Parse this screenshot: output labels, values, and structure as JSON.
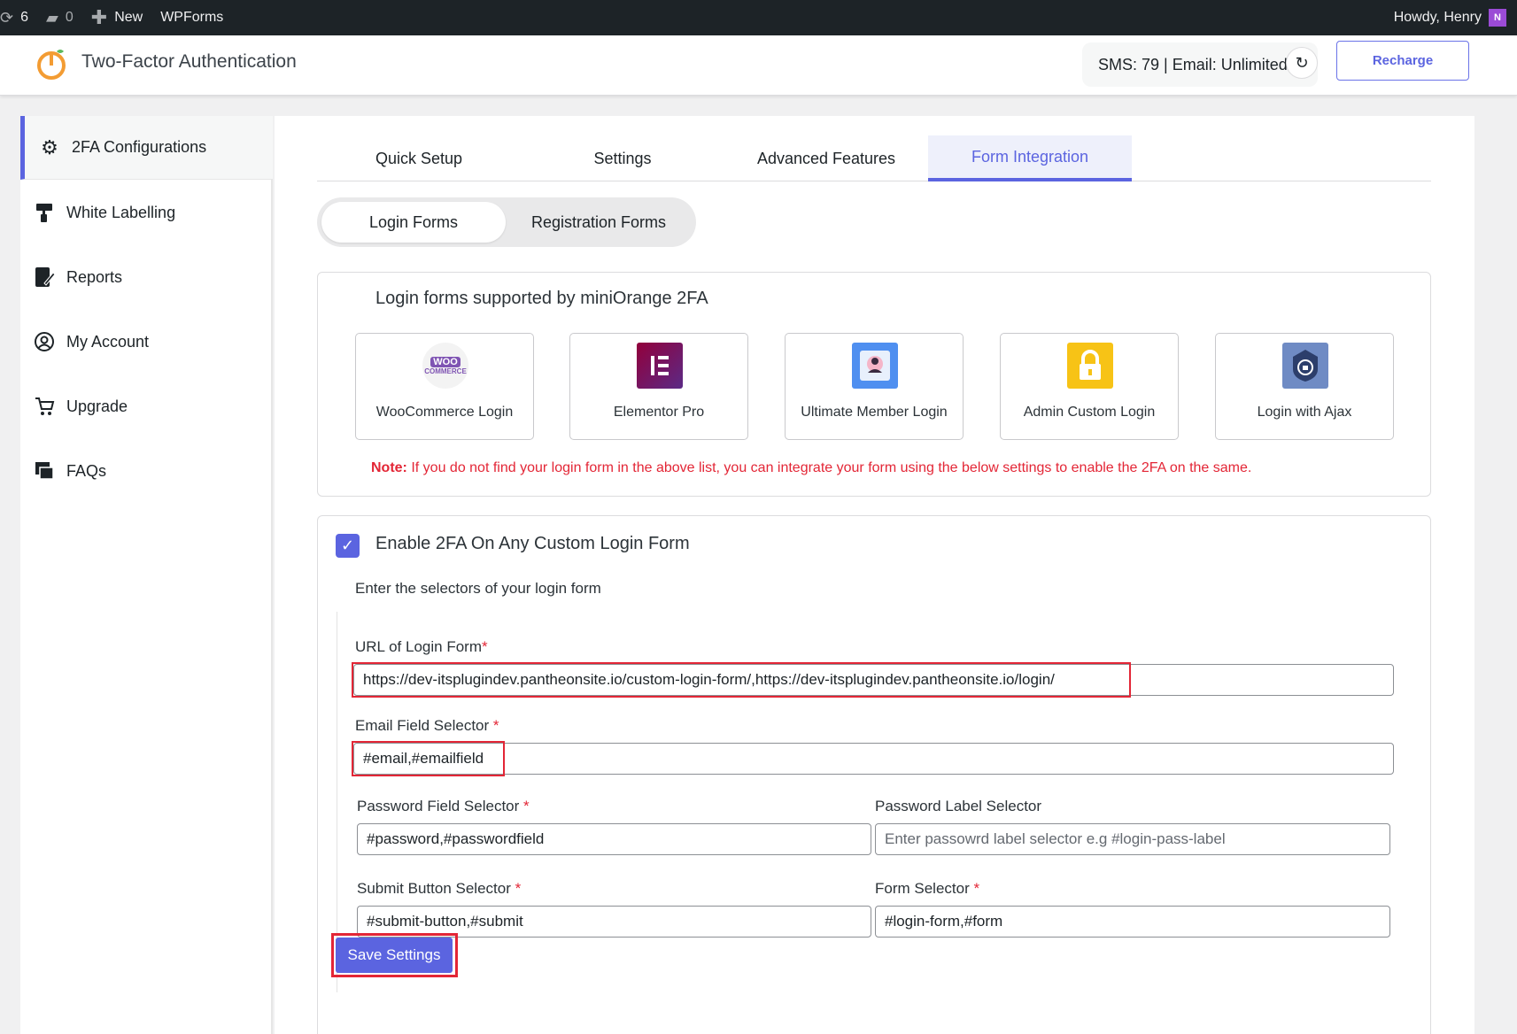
{
  "adminbar": {
    "updates_count": "6",
    "comments_count": "0",
    "new_label": "New",
    "wpforms_label": "WPForms",
    "greeting": "Howdy, Henry",
    "avatar_initial": "N"
  },
  "header": {
    "title": "Two-Factor Authentication",
    "credits": "SMS: 79 | Email: Unlimited",
    "recharge_label": "Recharge"
  },
  "sidebar": {
    "items": [
      {
        "label": "2FA Configurations",
        "icon": "gear-icon"
      },
      {
        "label": "White Labelling",
        "icon": "paint-roller-icon"
      },
      {
        "label": "Reports",
        "icon": "report-icon"
      },
      {
        "label": "My Account",
        "icon": "user-circle-icon"
      },
      {
        "label": "Upgrade",
        "icon": "cart-icon"
      },
      {
        "label": "FAQs",
        "icon": "faq-icon"
      }
    ]
  },
  "tabs": [
    "Quick Setup",
    "Settings",
    "Advanced Features",
    "Form Integration"
  ],
  "subtabs": [
    "Login Forms",
    "Registration Forms"
  ],
  "supported": {
    "title": "Login forms supported by miniOrange 2FA",
    "forms": [
      {
        "label": "WooCommerce Login",
        "icon_text": "WOO COMMERCE"
      },
      {
        "label": "Elementor Pro",
        "icon_text": "E"
      },
      {
        "label": "Ultimate Member Login",
        "icon_text": ""
      },
      {
        "label": "Admin Custom Login",
        "icon_text": ""
      },
      {
        "label": "Login with Ajax",
        "icon_text": ""
      }
    ],
    "note_prefix": "Note:",
    "note_text": " If you do not find your login form in the above list, you can integrate your form using the below settings to enable the 2FA on the same."
  },
  "custom": {
    "enable_label": "Enable 2FA On Any Custom Login Form",
    "sub_label": "Enter the selectors of your login form",
    "url_label": "URL of Login Form",
    "url_value": "https://dev-itsplugindev.pantheonsite.io/custom-login-form/,https://dev-itsplugindev.pantheonsite.io/login/",
    "email_label": "Email Field Selector ",
    "email_value": "#email,#emailfield",
    "password_label": "Password Field Selector ",
    "password_value": "#password,#passwordfield",
    "pass_label_label": "Password Label Selector",
    "pass_label_placeholder": "Enter passowrd label selector e.g #login-pass-label",
    "submit_label": "Submit Button Selector ",
    "submit_value": "#submit-button,#submit",
    "form_label": "Form Selector ",
    "form_value": "#login-form,#form",
    "required_mark": "*",
    "save_label": "Save Settings"
  },
  "colors": {
    "accent": "#5b64e0",
    "required": "#e32636"
  }
}
